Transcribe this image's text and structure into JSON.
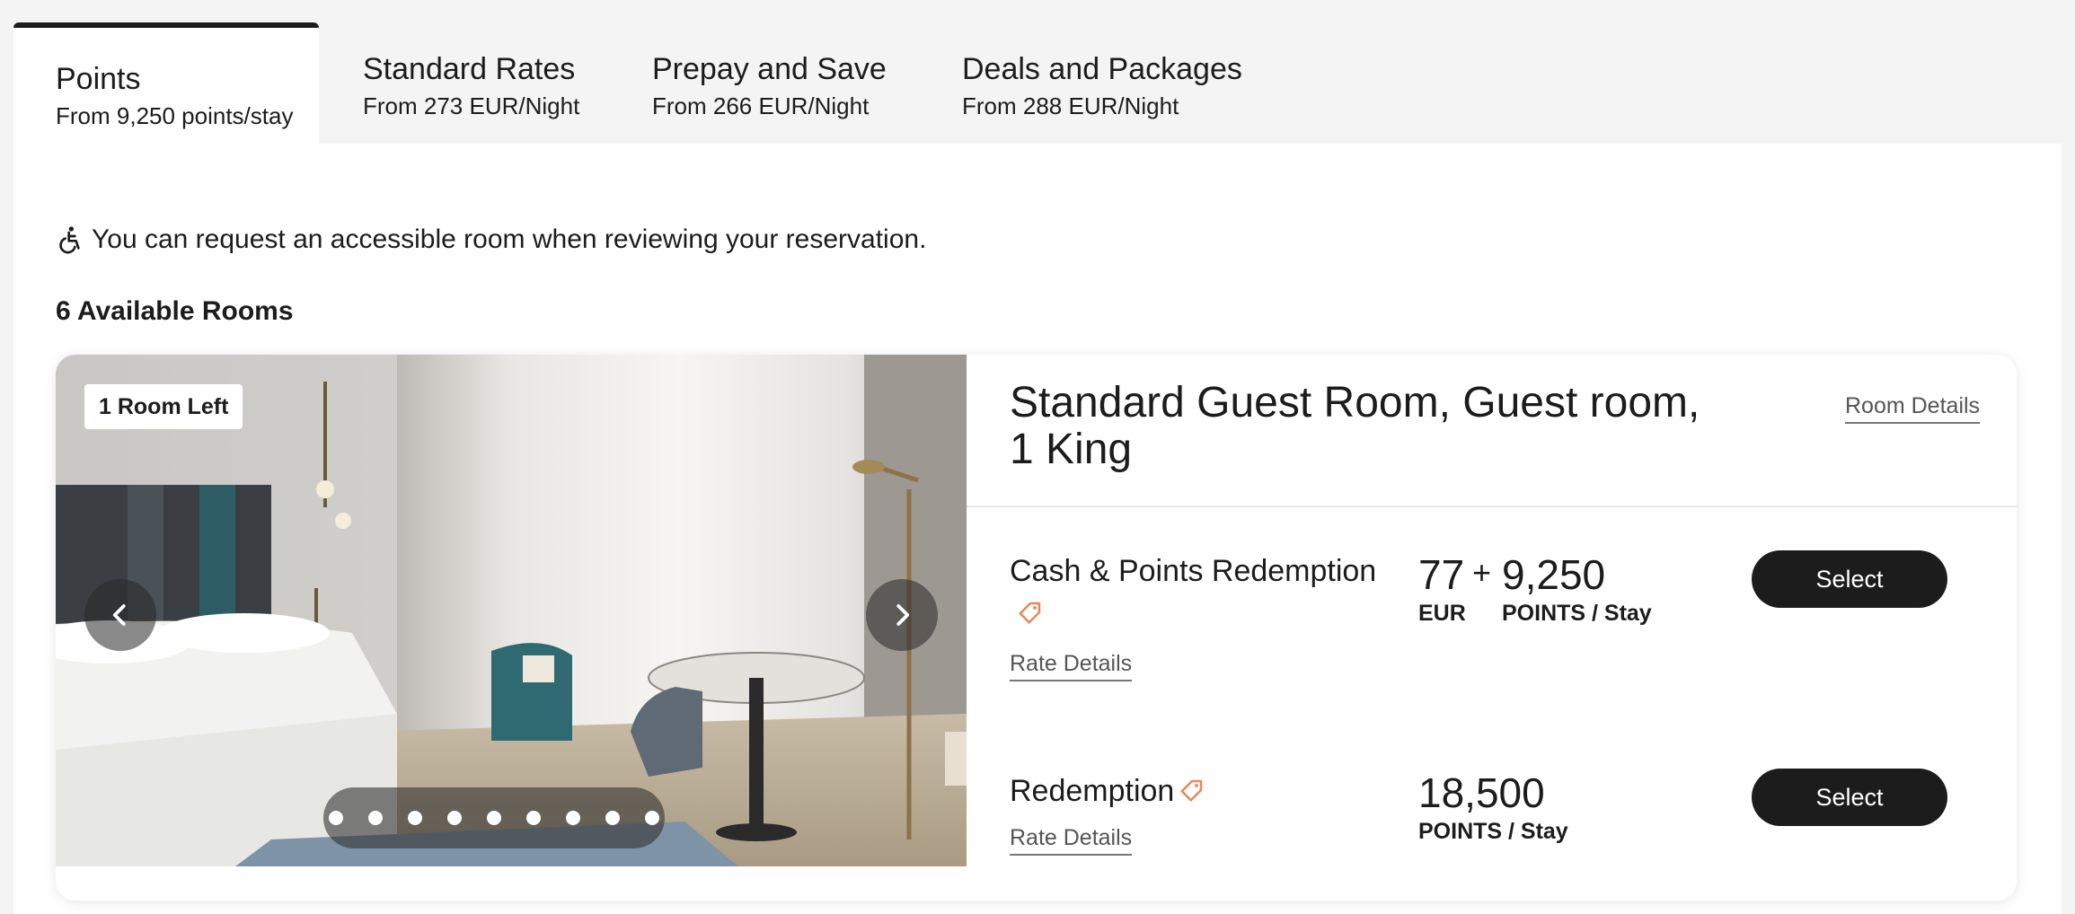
{
  "tabs": [
    {
      "title": "Points",
      "subtitle": "From 9,250 points/stay",
      "active": true
    },
    {
      "title": "Standard Rates",
      "subtitle": "From 273 EUR/Night",
      "active": false
    },
    {
      "title": "Prepay and Save",
      "subtitle": "From 266 EUR/Night",
      "active": false
    },
    {
      "title": "Deals and Packages",
      "subtitle": "From 288 EUR/Night",
      "active": false
    }
  ],
  "accessibility_note": "You can request an accessible room when reviewing your reservation.",
  "available_rooms": "6 Available Rooms",
  "room": {
    "badge": "1 Room Left",
    "title": "Standard Guest Room, Guest room, 1 King",
    "details_link": "Room Details",
    "carousel": {
      "total_images": 9,
      "current": 1
    },
    "rates": [
      {
        "name": "Cash & Points Redemption",
        "details_link": "Rate Details",
        "cash_amount": "77",
        "cash_unit": "EUR",
        "plus": "+",
        "points_amount": "9,250",
        "points_unit": "POINTS / Stay",
        "select_label": "Select"
      },
      {
        "name": "Redemption",
        "details_link": "Rate Details",
        "points_amount": "18,500",
        "points_unit": "POINTS / Stay",
        "select_label": "Select"
      }
    ]
  },
  "colors": {
    "accent_tag": "#e8875b",
    "button_bg": "#1c1c1c",
    "page_bg": "#f4f4f4"
  }
}
